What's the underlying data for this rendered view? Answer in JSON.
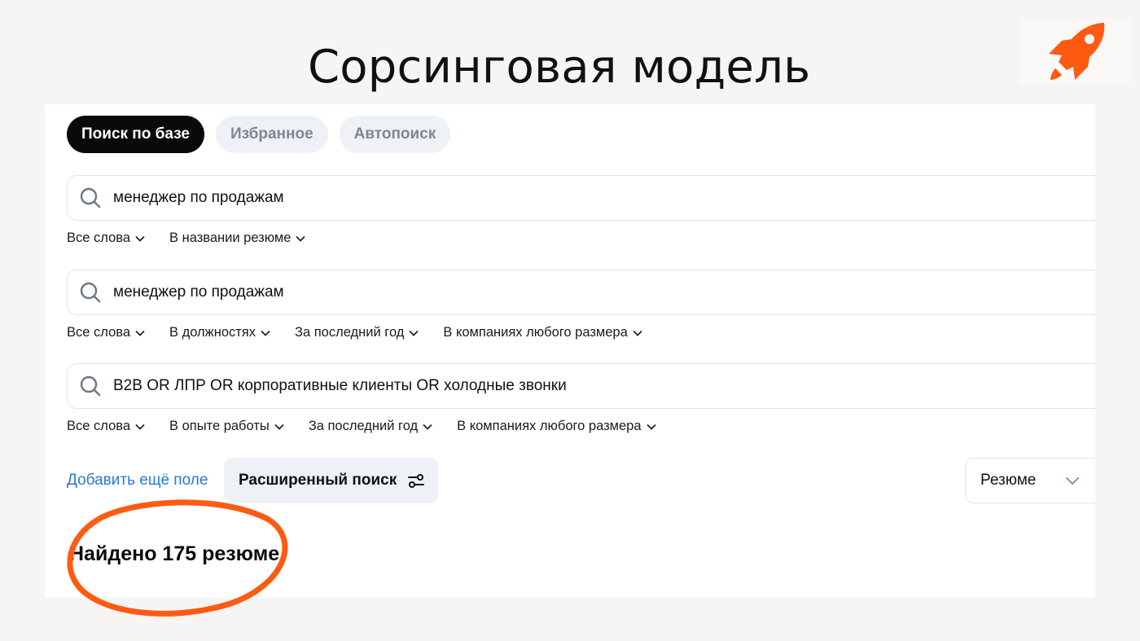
{
  "slide": {
    "title": "Сорсинговая модель"
  },
  "brand": {
    "logo_icon": "rocket-icon",
    "accent_color": "#ff5a12"
  },
  "tabs": [
    {
      "label": "Поиск по базе",
      "active": true
    },
    {
      "label": "Избранное",
      "active": false
    },
    {
      "label": "Автопоиск",
      "active": false
    }
  ],
  "queries": [
    {
      "value": "менеджер по продажам",
      "filters": [
        "Все слова",
        "В названии резюме"
      ]
    },
    {
      "value": "менеджер по продажам",
      "filters": [
        "Все слова",
        "В должностях",
        "За последний год",
        "В компаниях любого размера"
      ]
    },
    {
      "value": "B2B OR ЛПР OR корпоративные клиенты OR холодные звонки",
      "filters": [
        "Все слова",
        "В опыте работы",
        "За последний год",
        "В компаниях любого размера"
      ]
    }
  ],
  "actions": {
    "add_field": "Добавить ещё поле",
    "advanced_search": "Расширенный поиск",
    "type_select": "Резюме"
  },
  "results": {
    "found_text": "Найдено 175 резюме"
  },
  "colors": {
    "link": "#2a78d8",
    "active_tab_bg": "#0a0a0a",
    "tab_bg": "#eef1f6",
    "highlight_mark": "#ff5a12"
  }
}
